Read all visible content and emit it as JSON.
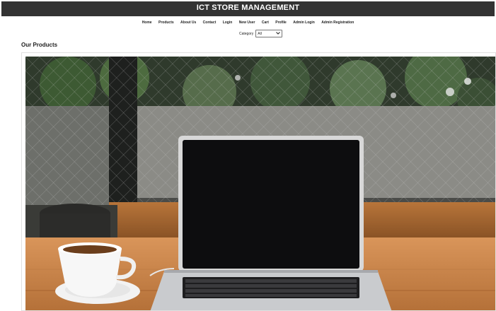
{
  "header": {
    "title": "ICT STORE MANAGEMENT"
  },
  "nav": {
    "items": [
      {
        "label": "Home"
      },
      {
        "label": "Products"
      },
      {
        "label": "About Us"
      },
      {
        "label": "Contact"
      },
      {
        "label": "Login"
      },
      {
        "label": "New User"
      },
      {
        "label": "Cart"
      },
      {
        "label": "Profile"
      },
      {
        "label": "Admin Login"
      },
      {
        "label": "Admin Registration"
      }
    ]
  },
  "category": {
    "label": "Category",
    "selected": "All"
  },
  "section": {
    "title": "Our Products"
  },
  "colors": {
    "header_bg": "#333333",
    "header_text": "#ffffff"
  }
}
